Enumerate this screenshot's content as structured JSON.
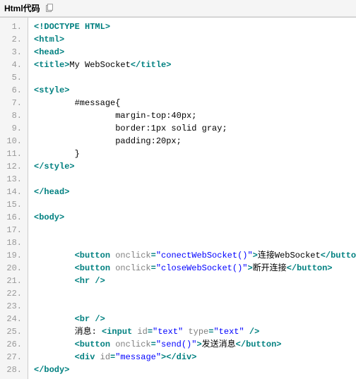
{
  "header": {
    "title": "Html代码"
  },
  "lines": [
    {
      "n": "1.",
      "segs": [
        {
          "t": "<!DOCTYPE HTML>",
          "c": "tag"
        }
      ]
    },
    {
      "n": "2.",
      "segs": [
        {
          "t": "<html>",
          "c": "tag"
        }
      ]
    },
    {
      "n": "3.",
      "segs": [
        {
          "t": "<head>",
          "c": "tag"
        }
      ]
    },
    {
      "n": "4.",
      "segs": [
        {
          "t": "<title>",
          "c": "tag"
        },
        {
          "t": "My WebSocket",
          "c": "text"
        },
        {
          "t": "</title>",
          "c": "tag"
        }
      ]
    },
    {
      "n": "5.",
      "segs": []
    },
    {
      "n": "6.",
      "segs": [
        {
          "t": "<style>",
          "c": "tag"
        }
      ]
    },
    {
      "n": "7.",
      "segs": [
        {
          "t": "        #message{",
          "c": "css-sel"
        }
      ]
    },
    {
      "n": "8.",
      "segs": [
        {
          "t": "                margin-top:40px;",
          "c": "css-prop"
        }
      ]
    },
    {
      "n": "9.",
      "segs": [
        {
          "t": "                border:1px solid gray;",
          "c": "css-prop"
        }
      ]
    },
    {
      "n": "10.",
      "segs": [
        {
          "t": "                padding:20px;",
          "c": "css-prop"
        }
      ]
    },
    {
      "n": "11.",
      "segs": [
        {
          "t": "        }",
          "c": "css-sel"
        }
      ]
    },
    {
      "n": "12.",
      "segs": [
        {
          "t": "</style>",
          "c": "tag"
        }
      ]
    },
    {
      "n": "13.",
      "segs": []
    },
    {
      "n": "14.",
      "segs": [
        {
          "t": "</head>",
          "c": "tag"
        }
      ]
    },
    {
      "n": "15.",
      "segs": []
    },
    {
      "n": "16.",
      "segs": [
        {
          "t": "<body>",
          "c": "tag"
        }
      ]
    },
    {
      "n": "17.",
      "segs": []
    },
    {
      "n": "18.",
      "segs": []
    },
    {
      "n": "19.",
      "segs": [
        {
          "t": "        ",
          "c": "text"
        },
        {
          "t": "<button ",
          "c": "tag"
        },
        {
          "t": "onclick",
          "c": "attr"
        },
        {
          "t": "=",
          "c": "tag"
        },
        {
          "t": "\"conectWebSocket()\"",
          "c": "string"
        },
        {
          "t": ">",
          "c": "tag"
        },
        {
          "t": "连接WebSocket",
          "c": "text"
        },
        {
          "t": "</button>",
          "c": "tag"
        }
      ]
    },
    {
      "n": "20.",
      "segs": [
        {
          "t": "        ",
          "c": "text"
        },
        {
          "t": "<button ",
          "c": "tag"
        },
        {
          "t": "onclick",
          "c": "attr"
        },
        {
          "t": "=",
          "c": "tag"
        },
        {
          "t": "\"closeWebSocket()\"",
          "c": "string"
        },
        {
          "t": ">",
          "c": "tag"
        },
        {
          "t": "断开连接",
          "c": "text"
        },
        {
          "t": "</button>",
          "c": "tag"
        }
      ]
    },
    {
      "n": "21.",
      "segs": [
        {
          "t": "        ",
          "c": "text"
        },
        {
          "t": "<hr />",
          "c": "tag"
        }
      ]
    },
    {
      "n": "22.",
      "segs": []
    },
    {
      "n": "23.",
      "segs": []
    },
    {
      "n": "24.",
      "segs": [
        {
          "t": "        ",
          "c": "text"
        },
        {
          "t": "<br />",
          "c": "tag"
        }
      ]
    },
    {
      "n": "25.",
      "segs": [
        {
          "t": "        消息:",
          "c": "text"
        },
        {
          "t": " <input ",
          "c": "tag"
        },
        {
          "t": "id",
          "c": "attr"
        },
        {
          "t": "=",
          "c": "tag"
        },
        {
          "t": "\"text\"",
          "c": "string"
        },
        {
          "t": " type",
          "c": "attr"
        },
        {
          "t": "=",
          "c": "tag"
        },
        {
          "t": "\"text\"",
          "c": "string"
        },
        {
          "t": " />",
          "c": "tag"
        }
      ]
    },
    {
      "n": "26.",
      "segs": [
        {
          "t": "        ",
          "c": "text"
        },
        {
          "t": "<button ",
          "c": "tag"
        },
        {
          "t": "onclick",
          "c": "attr"
        },
        {
          "t": "=",
          "c": "tag"
        },
        {
          "t": "\"send()\"",
          "c": "string"
        },
        {
          "t": ">",
          "c": "tag"
        },
        {
          "t": "发送消息",
          "c": "text"
        },
        {
          "t": "</button>",
          "c": "tag"
        }
      ]
    },
    {
      "n": "27.",
      "segs": [
        {
          "t": "        ",
          "c": "text"
        },
        {
          "t": "<div ",
          "c": "tag"
        },
        {
          "t": "id",
          "c": "attr"
        },
        {
          "t": "=",
          "c": "tag"
        },
        {
          "t": "\"message\"",
          "c": "string"
        },
        {
          "t": "></div>",
          "c": "tag"
        }
      ]
    },
    {
      "n": "28.",
      "segs": [
        {
          "t": "</body>",
          "c": "tag"
        }
      ]
    }
  ]
}
